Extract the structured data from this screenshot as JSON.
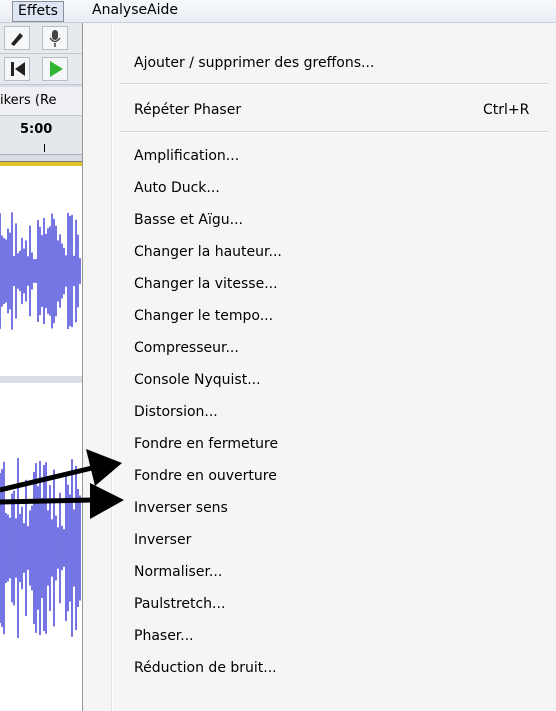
{
  "menubar": {
    "items": [
      {
        "label": "Effets"
      },
      {
        "label": "Analyse"
      },
      {
        "label": "Aide"
      }
    ]
  },
  "app": {
    "device_label": "ikers (Re",
    "ruler_time": "5:00",
    "colors": {
      "waveform": "#3a3ad8",
      "ruler_line": "#e1c52a"
    }
  },
  "effects_menu": {
    "manage_plugins": "Ajouter / supprimer des greffons...",
    "repeat": {
      "label": "Répéter Phaser",
      "shortcut": "Ctrl+R"
    },
    "items": [
      "Amplification...",
      "Auto Duck...",
      "Basse et Aïgu...",
      "Changer la hauteur...",
      "Changer la vitesse...",
      "Changer le tempo...",
      "Compresseur...",
      "Console Nyquist...",
      "Distorsion...",
      "Fondre en fermeture",
      "Fondre en ouverture",
      "Inverser sens",
      "Inverser",
      "Normaliser...",
      "Paulstretch...",
      "Phaser...",
      "Réduction de bruit..."
    ]
  },
  "annotations": {
    "arrow_color": "#000000",
    "arrows_point_to": [
      "Fondre en fermeture",
      "Fondre en ouverture"
    ]
  }
}
